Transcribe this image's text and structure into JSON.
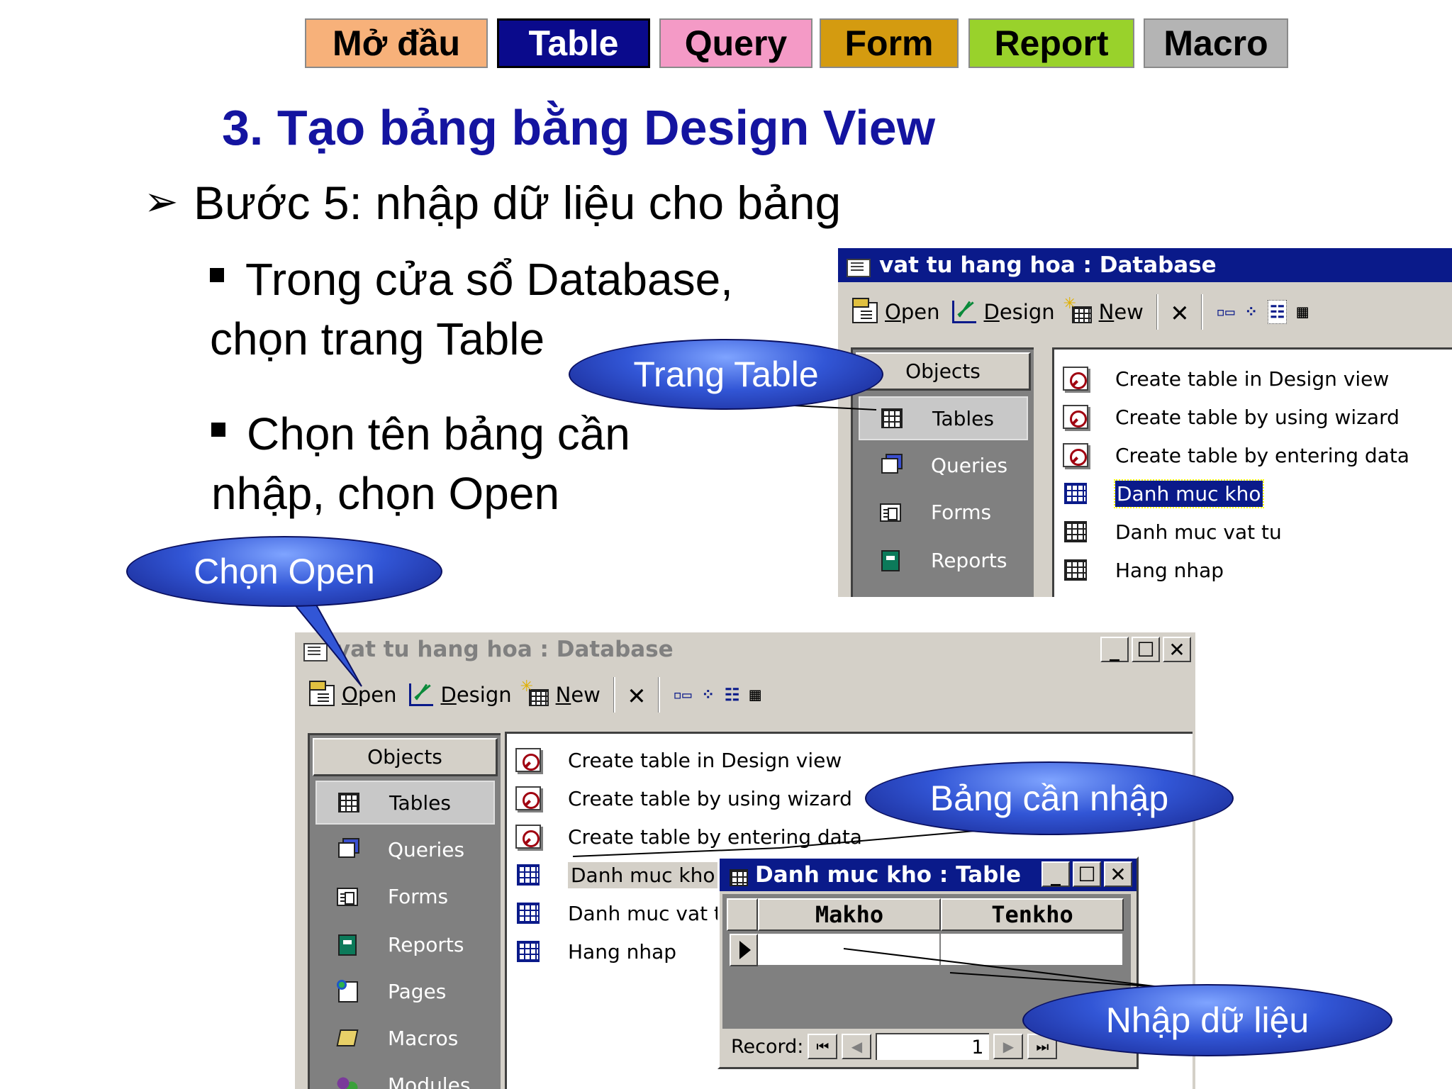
{
  "nav": {
    "items": [
      {
        "label": "Mở đầu",
        "color": "#f7b17a"
      },
      {
        "label": "Table",
        "color": "#0a0a8c"
      },
      {
        "label": "Query",
        "color": "#f49ac6"
      },
      {
        "label": "Form",
        "color": "#d49b10"
      },
      {
        "label": "Report",
        "color": "#99d22b"
      },
      {
        "label": "Macro",
        "color": "#b4b4b4"
      }
    ],
    "active": "Table"
  },
  "slide": {
    "title": "3. Tạo bảng bằng Design View",
    "step": "Bước 5: nhập dữ liệu cho bảng",
    "bullet1_line1": "Trong cửa sổ Database,",
    "bullet1_line2": "chọn trang Table",
    "bullet2_line1": "Chọn tên bảng cần",
    "bullet2_line2": "nhập, chọn Open"
  },
  "callouts": {
    "trang_table": "Trang Table",
    "chon_open": "Chọn Open",
    "bang_can_nhap": "Bảng cần nhập",
    "nhap_du_lieu": "Nhập dữ liệu"
  },
  "db_window_top": {
    "title": "vat tu hang hoa : Database",
    "toolbar": {
      "open": "Open",
      "design": "Design",
      "new": "New"
    },
    "objects_header": "Objects",
    "objects": [
      "Tables",
      "Queries",
      "Forms",
      "Reports"
    ],
    "items": [
      "Create table in Design view",
      "Create table by using wizard",
      "Create table by entering data",
      "Danh muc kho",
      "Danh muc vat tu",
      "Hang nhap"
    ],
    "selected_item": "Danh muc kho"
  },
  "db_window_bottom": {
    "title": "vat tu hang hoa : Database",
    "toolbar": {
      "open": "Open",
      "design": "Design",
      "new": "New"
    },
    "objects_header": "Objects",
    "objects": [
      "Tables",
      "Queries",
      "Forms",
      "Reports",
      "Pages",
      "Macros",
      "Modules"
    ],
    "items": [
      "Create table in Design view",
      "Create table by using wizard",
      "Create table by entering data",
      "Danh muc kho",
      "Danh muc vat tu",
      "Hang nhap"
    ]
  },
  "table_window": {
    "title": "Danh muc kho : Table",
    "columns": [
      "Makho",
      "Tenkho"
    ],
    "record_label": "Record:",
    "record_value": "1"
  },
  "icons": {
    "title_icon": "database-icon",
    "close": "close-icon",
    "minimize": "minimize-icon",
    "maximize": "maximize-icon",
    "delete": "delete-x-icon"
  }
}
